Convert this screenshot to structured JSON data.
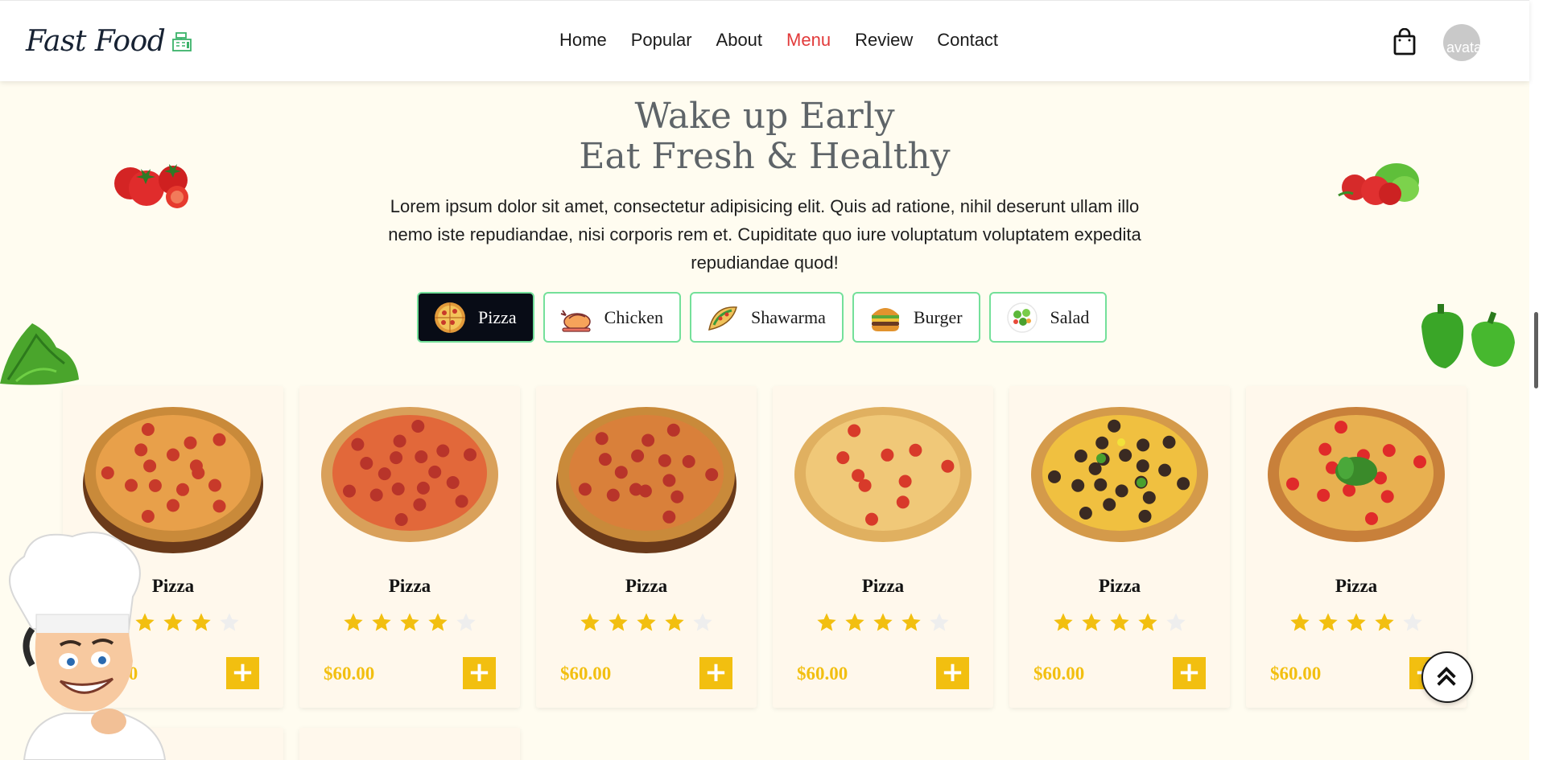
{
  "header": {
    "logo_text": "Fast Food",
    "nav": [
      {
        "label": "Home"
      },
      {
        "label": "Popular"
      },
      {
        "label": "About"
      },
      {
        "label": "Menu",
        "active": true
      },
      {
        "label": "Review"
      },
      {
        "label": "Contact"
      }
    ],
    "avatar_alt": "avatar"
  },
  "hero": {
    "title_line1": "Wake up Early",
    "title_line2": "Eat Fresh & Healthy",
    "description": "Lorem ipsum dolor sit amet, consectetur adipisicing elit. Quis ad ratione, nihil deserunt ullam illo nemo iste repudiandae, nisi corporis rem et. Cupiditate quo iure voluptatum voluptatem expedita repudiandae quod!"
  },
  "tabs": [
    {
      "label": "Pizza",
      "icon": "pizza-icon",
      "active": true
    },
    {
      "label": "Chicken",
      "icon": "chicken-icon"
    },
    {
      "label": "Shawarma",
      "icon": "taco-icon"
    },
    {
      "label": "Burger",
      "icon": "burger-icon"
    },
    {
      "label": "Salad",
      "icon": "salad-icon"
    }
  ],
  "products": [
    {
      "name": "Pizza",
      "price": "$60.00",
      "rating": 4,
      "max_rating": 5
    },
    {
      "name": "Pizza",
      "price": "$60.00",
      "rating": 4,
      "max_rating": 5
    },
    {
      "name": "Pizza",
      "price": "$60.00",
      "rating": 4,
      "max_rating": 5
    },
    {
      "name": "Pizza",
      "price": "$60.00",
      "rating": 4,
      "max_rating": 5
    },
    {
      "name": "Pizza",
      "price": "$60.00",
      "rating": 4,
      "max_rating": 5
    },
    {
      "name": "Pizza",
      "price": "$60.00",
      "rating": 4,
      "max_rating": 5
    }
  ],
  "add_label": "+",
  "colors": {
    "accent": "#f2bf10",
    "nav_active": "#e23a3a",
    "tab_border": "#74e09a",
    "tab_active_bg": "#080c16",
    "page_bg": "#fffcf0",
    "star_empty": "#eeeeee"
  }
}
